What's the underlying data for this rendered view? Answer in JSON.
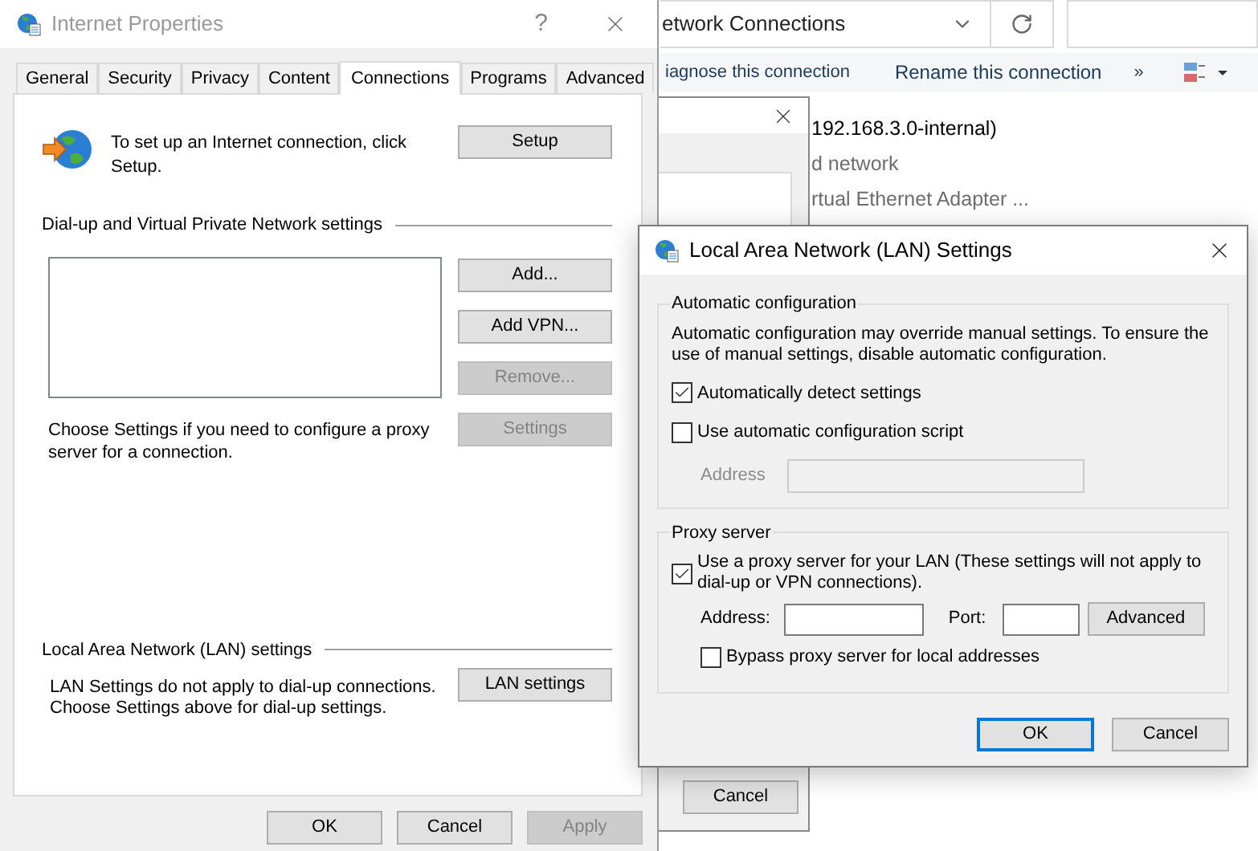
{
  "background_window": {
    "address": "etwork Connections",
    "toolbar": [
      "iagnose this connection",
      "Rename this connection",
      "»"
    ],
    "item": {
      "name": "192.168.3.0-internal)",
      "status": "d network",
      "device": "rtual Ethernet Adapter ..."
    }
  },
  "middle_dialog": {
    "buttons": [
      "Cancel"
    ]
  },
  "internet_properties": {
    "title": "Internet Properties",
    "help": "?",
    "tabs": [
      {
        "label": "General",
        "selected": false
      },
      {
        "label": "Security",
        "selected": false
      },
      {
        "label": "Privacy",
        "selected": false
      },
      {
        "label": "Content",
        "selected": false
      },
      {
        "label": "Connections",
        "selected": true
      },
      {
        "label": "Programs",
        "selected": false
      },
      {
        "label": "Advanced",
        "selected": false
      }
    ],
    "setup": {
      "text": "To set up an Internet connection, click Setup.",
      "button": "Setup"
    },
    "dialup": {
      "heading": "Dial-up and Virtual Private Network settings",
      "buttons": [
        {
          "label": "Add...",
          "disabled": false
        },
        {
          "label": "Add VPN...",
          "disabled": false
        },
        {
          "label": "Remove...",
          "disabled": true
        },
        {
          "label": "Settings",
          "disabled": true
        }
      ],
      "note": "Choose Settings if you need to configure a proxy server for a connection."
    },
    "lan": {
      "heading": "Local Area Network (LAN) settings",
      "lines": [
        "LAN Settings do not apply to dial-up connections.",
        "Choose Settings above for dial-up settings."
      ],
      "button": "LAN settings"
    },
    "buttons": [
      {
        "label": "OK",
        "disabled": false
      },
      {
        "label": "Cancel",
        "disabled": false
      },
      {
        "label": "Apply",
        "disabled": true
      }
    ]
  },
  "lan_dialog": {
    "title": "Local Area Network (LAN) Settings",
    "automatic": {
      "heading": "Automatic configuration",
      "text": "Automatic configuration may override manual settings.  To ensure the use of manual settings, disable automatic configuration.",
      "options": [
        {
          "label": "Automatically detect settings",
          "checked": true
        },
        {
          "label": "Use automatic configuration script",
          "checked": false
        }
      ],
      "address": {
        "label": "Address",
        "disabled": true
      }
    },
    "proxy": {
      "heading": "Proxy server",
      "use_proxy": {
        "label": "Use a proxy server for your LAN (These settings will not apply to dial-up or VPN connections).",
        "checked": true
      },
      "address_label": "Address:",
      "port_label": "Port:",
      "advanced": "Advanced",
      "bypass": {
        "label": "Bypass proxy server for local addresses",
        "checked": false
      }
    },
    "buttons": [
      {
        "label": "OK",
        "default": true
      },
      {
        "label": "Cancel",
        "default": false
      }
    ]
  }
}
